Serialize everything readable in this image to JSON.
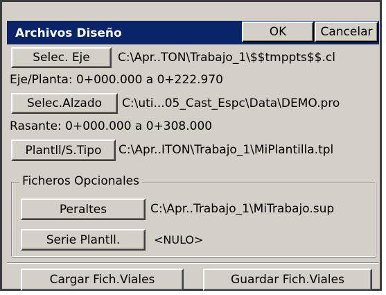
{
  "window": {
    "title": "Archivos Diseño",
    "ok_label": "OK",
    "cancel_label": "Cancelar"
  },
  "alignment": {
    "button_label": "Selec. Eje",
    "path": "C:\\Apr..TON\\Trabajo_1\\$$tmppts$$.cl",
    "range": "Eje/Planta: 0+000.000 a 0+222.970"
  },
  "profile": {
    "button_label": "Selec.Alzado",
    "path": "C:\\uti...05_Cast_Espc\\Data\\DEMO.pro",
    "range": "Rasante: 0+000.000 a 0+308.000"
  },
  "template": {
    "button_label": "Plantll/S.Tipo",
    "path": "C:\\Apr..ITON\\Trabajo_1\\MiPlantilla.tpl"
  },
  "optional_files": {
    "legend": "Ficheros Opcionales",
    "superelevation": {
      "button_label": "Peraltes",
      "path": "C:\\Apr..Trabajo_1\\MiTrabajo.sup"
    },
    "template_series": {
      "button_label": "Serie Plantll.",
      "path": "<NULO>"
    }
  },
  "footer": {
    "load_label": "Cargar Fich.Viales",
    "save_label": "Guardar Fich.Viales"
  },
  "colors": {
    "titlebar": "#0a246a",
    "face": "#d4d0c8"
  }
}
